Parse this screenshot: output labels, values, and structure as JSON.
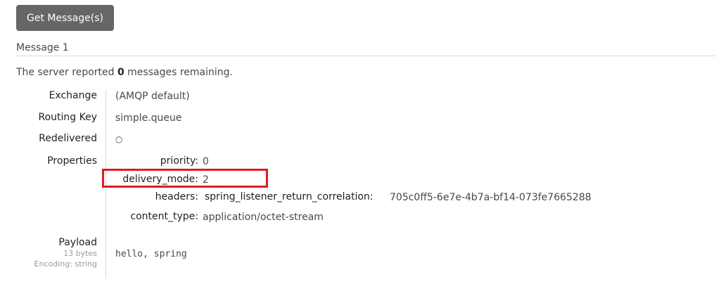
{
  "toolbar": {
    "get_messages_label": "Get Message(s)"
  },
  "message": {
    "title": "Message 1",
    "summary_prefix": "The server reported ",
    "summary_count": "0",
    "summary_suffix": " messages remaining.",
    "exchange_label": "Exchange",
    "exchange_value": "(AMQP default)",
    "routing_key_label": "Routing Key",
    "routing_key_value": "simple.queue",
    "redelivered_label": "Redelivered",
    "redelivered_value": "○",
    "properties_label": "Properties",
    "properties": [
      {
        "key": "priority:",
        "value": "0"
      },
      {
        "key": "delivery_mode:",
        "value": "2"
      },
      {
        "key": "headers:",
        "subkey": "spring_listener_return_correlation:",
        "value": "705c0ff5-6e7e-4b7a-bf14-073fe7665288"
      },
      {
        "key": "content_type:",
        "value": "application/octet-stream"
      }
    ],
    "payload_label": "Payload",
    "payload_size": "13 bytes",
    "payload_encoding": "Encoding: string",
    "payload_value": "hello, spring"
  },
  "colors": {
    "button_bg": "#666666",
    "highlight": "#e01b24"
  }
}
